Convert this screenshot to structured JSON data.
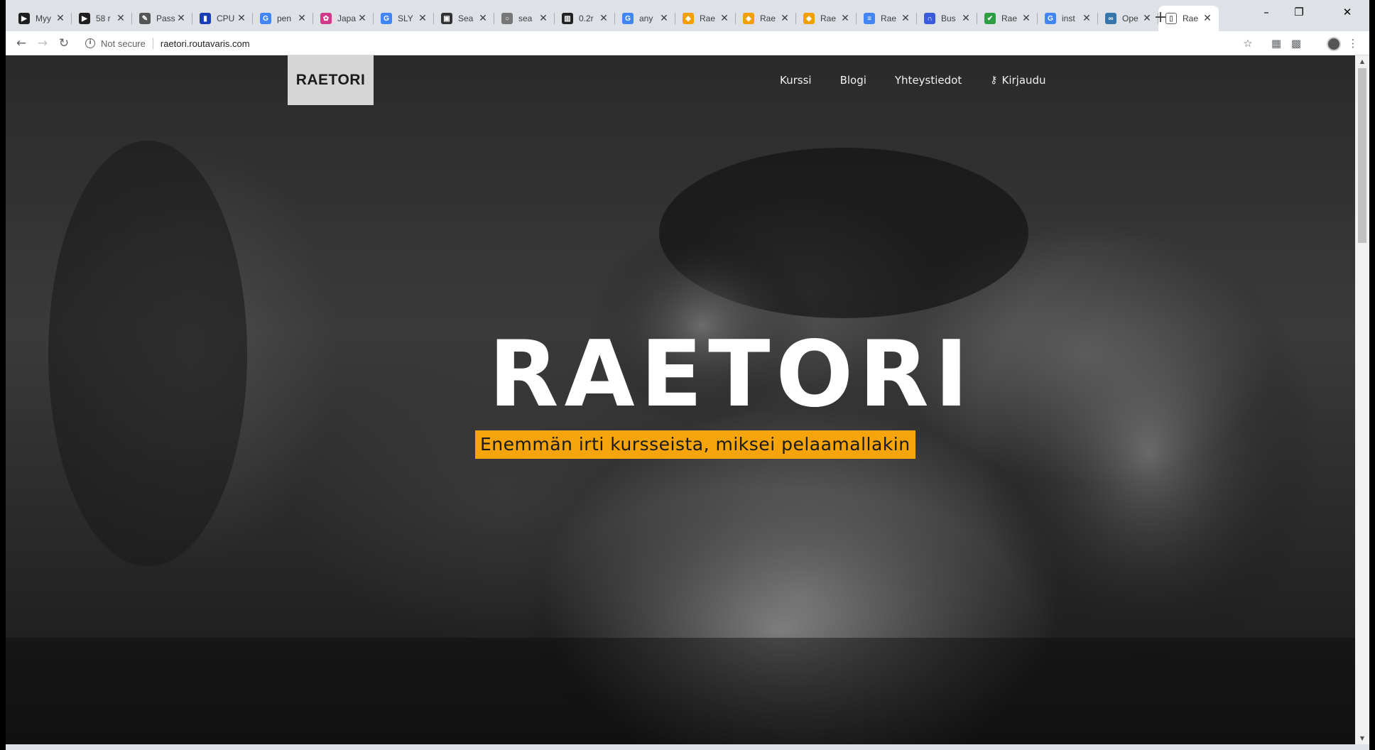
{
  "browser": {
    "tabs": [
      {
        "title": "Myy",
        "favicon": "youtube-icon",
        "color": "#1f1f1f",
        "glyph": "▶"
      },
      {
        "title": "58 r",
        "favicon": "youtube-icon",
        "color": "#1f1f1f",
        "glyph": "▶"
      },
      {
        "title": "Pass",
        "favicon": "book-icon",
        "color": "#555555",
        "glyph": "✎"
      },
      {
        "title": "CPU",
        "favicon": "bar-chart-icon",
        "color": "#1a3fb5",
        "glyph": "▮"
      },
      {
        "title": "pen",
        "favicon": "google-icon",
        "color": "#4285f4",
        "glyph": "G"
      },
      {
        "title": "Japa",
        "favicon": "japan-icon",
        "color": "#d03a8a",
        "glyph": "✿"
      },
      {
        "title": "SLY",
        "favicon": "google-icon",
        "color": "#4285f4",
        "glyph": "G"
      },
      {
        "title": "Sea",
        "favicon": "bag-icon",
        "color": "#333333",
        "glyph": "▣"
      },
      {
        "title": "sea",
        "favicon": "lock-icon",
        "color": "#777777",
        "glyph": "○"
      },
      {
        "title": "0.2r",
        "favicon": "film-icon",
        "color": "#222222",
        "glyph": "▥"
      },
      {
        "title": "any",
        "favicon": "google-icon",
        "color": "#4285f4",
        "glyph": "G"
      },
      {
        "title": "Rae",
        "favicon": "raetori-icon",
        "color": "#f29f05",
        "glyph": "◈"
      },
      {
        "title": "Rae",
        "favicon": "raetori-icon",
        "color": "#f29f05",
        "glyph": "◈"
      },
      {
        "title": "Rae",
        "favicon": "raetori-icon",
        "color": "#f29f05",
        "glyph": "◈"
      },
      {
        "title": "Rae",
        "favicon": "docs-icon",
        "color": "#4285f4",
        "glyph": "≡"
      },
      {
        "title": "Bus",
        "favicon": "bus-icon",
        "color": "#3b5bdb",
        "glyph": "∩"
      },
      {
        "title": "Rae",
        "favicon": "check-icon",
        "color": "#2e9e44",
        "glyph": "✔"
      },
      {
        "title": "inst",
        "favicon": "google-icon",
        "color": "#4285f4",
        "glyph": "G"
      },
      {
        "title": "Ope",
        "favicon": "python-icon",
        "color": "#3776ab",
        "glyph": "∞"
      },
      {
        "title": "Rae",
        "favicon": "page-icon",
        "color": "#ffffff",
        "glyph": "▯",
        "active": true
      }
    ],
    "new_tab_label": "+",
    "window_controls": {
      "minimize": "–",
      "restore": "❐",
      "close": "✕"
    },
    "nav": {
      "back": "←",
      "forward": "→",
      "reload": "↻"
    },
    "security_label": "Not secure",
    "url": "raetori.routavaris.com",
    "toolbar_icons": {
      "bookmark": "☆",
      "extension1": "▦",
      "extension2": "▩",
      "menu": "⋮"
    }
  },
  "site": {
    "logo": "RAETORI",
    "nav": {
      "kurssi": "Kurssi",
      "blogi": "Blogi",
      "yhteystiedot": "Yhteystiedot",
      "kirjaudu": "Kirjaudu"
    },
    "hero_title": "RAETORI",
    "tagline": "Enemmän irti kursseista, miksei pelaamallakin",
    "accent_color": "#f5a50b"
  }
}
